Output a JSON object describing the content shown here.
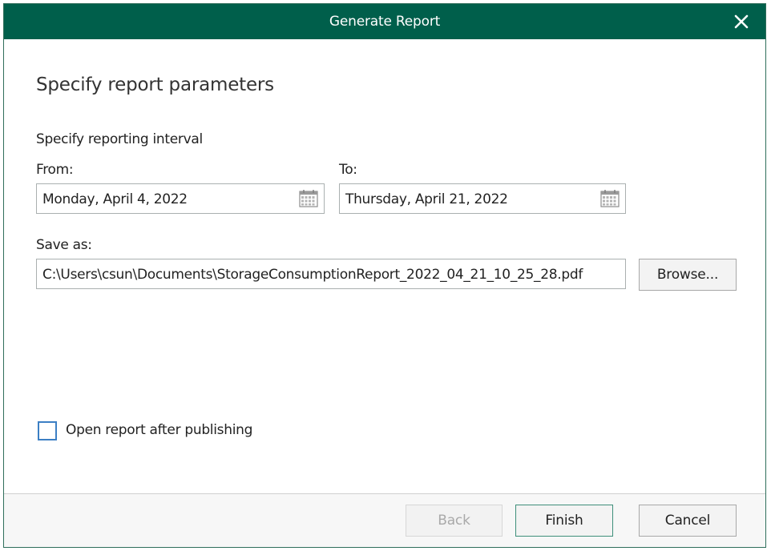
{
  "window": {
    "title": "Generate Report",
    "close_icon": "close-icon",
    "accent_color": "#005f4b"
  },
  "page": {
    "heading": "Specify report parameters",
    "interval_label": "Specify reporting interval"
  },
  "from": {
    "label": "From:",
    "value": "Monday, April 4, 2022",
    "icon": "calendar-icon"
  },
  "to": {
    "label": "To:",
    "value": "Thursday, April 21, 2022",
    "icon": "calendar-icon"
  },
  "save_as": {
    "label": "Save as:",
    "value": "C:\\Users\\csun\\Documents\\StorageConsumptionReport_2022_04_21_10_25_28.pdf",
    "browse_label": "Browse..."
  },
  "options": {
    "open_after_label": "Open report after publishing",
    "open_after_checked": false
  },
  "footer": {
    "back_label": "Back",
    "back_enabled": false,
    "finish_label": "Finish",
    "cancel_label": "Cancel"
  }
}
